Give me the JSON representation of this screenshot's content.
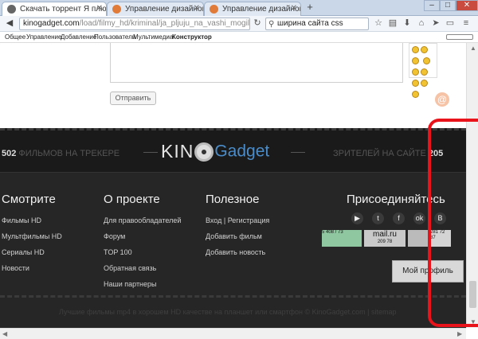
{
  "tabs": [
    {
      "title": "Скачать торрент Я плюю н...",
      "active": true
    },
    {
      "title": "Управление дизайном - П...",
      "active": false
    },
    {
      "title": "Управление дизайном - П...",
      "active": false
    }
  ],
  "nav": {
    "url_host": "kinogadget.com",
    "url_path": "/load/filmy_hd/kriminal/ja_pljuju_na_vashi_mogily",
    "search_value": "ширина сайта css"
  },
  "menu": [
    "Общее",
    "Управление",
    "Добавление",
    "Пользователи",
    "Мультимедиа",
    "Конструктор"
  ],
  "comment": {
    "send_label": "Отправить"
  },
  "footer": {
    "left_count": "502",
    "left_text": "ФИЛЬМОВ НА ТРЕКЕРЕ",
    "right_text": "ЗРИТЕЛЕЙ НА САЙТЕ",
    "right_count": "205",
    "logo_kin": "KIN",
    "logo_gadget": "Gadget",
    "col1": {
      "title": "Смотрите",
      "links": [
        "Фильмы HD",
        "Мультфильмы HD",
        "Сериалы HD",
        "Новости"
      ]
    },
    "col2": {
      "title": "О проекте",
      "links": [
        "Для правообладателей",
        "Форум",
        "TOP 100",
        "Обратная связь",
        "Наши партнеры"
      ]
    },
    "col3": {
      "title": "Полезное",
      "links": [
        "Вход | Регистрация",
        "Добавить фильм",
        "Добавить новость"
      ]
    },
    "col4": {
      "title": "Присоединяйтесь"
    },
    "counters": {
      "mailru_label": "mail.ru",
      "mailru_nums": "209  78",
      "left_nums": "5 408 / 73",
      "right_nums": "281 72 87"
    },
    "copyright": "Лучшие фильмы mp4 в хорошем HD качестве на планшет или смартфон © KinoGadget.com | sitemap",
    "profile_label": "Мой профиль"
  },
  "colors": {
    "accent_blue": "#4a8cc9",
    "footer_bg": "#262626",
    "annotation_red": "#e8131b"
  }
}
